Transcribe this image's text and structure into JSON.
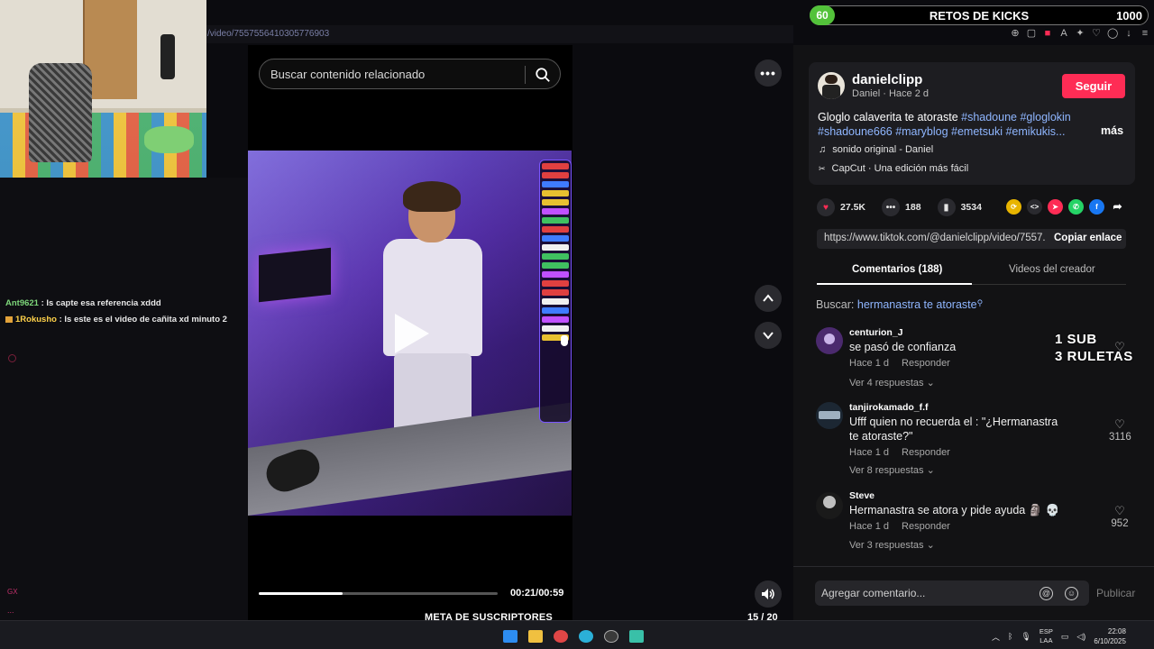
{
  "browser": {
    "url_fragment": "/video/7557556410305776903"
  },
  "chat": {
    "messages": [
      {
        "user": "Ant9621",
        "text": ": Is capte esa referencia xddd",
        "user_color": "#7dd67a"
      },
      {
        "user": "1Rokusho",
        "text": ": Is este es el video de cañita xd minuto 2",
        "user_color": "#ffd24a"
      }
    ],
    "footer_tag": "GX",
    "footer_more": "..."
  },
  "video_panel": {
    "search_placeholder": "Buscar contenido relacionado",
    "time": "00:21/00:59",
    "progress": 0.35
  },
  "kicks_overlay": {
    "badge": "60",
    "title": "RETOS DE KICKS",
    "goal": "1000"
  },
  "post": {
    "creator": "danielclipp",
    "subline": "Daniel · Hace 2 d",
    "follow_label": "Seguir",
    "caption": "Gloglo calaverita te atoraste ",
    "hashtags_line1": "#shadoune #gloglokin",
    "hashtags_line2": "#shadoune666 #maryblog #emetsuki #emikukis...",
    "more_label": "más",
    "sound": "sonido original - Daniel",
    "capcut": "CapCut · Una edición más fácil",
    "likes": "27.5K",
    "comments": "188",
    "saves": "3534",
    "link": "https://www.tiktok.com/@danielclipp/video/7557...",
    "copy_label": "Copiar enlace"
  },
  "tabs": {
    "comments": "Comentarios (188)",
    "creator_videos": "Videos del creador"
  },
  "search_suggestion": {
    "label": "Buscar:",
    "query": "hermanastra te atoraste"
  },
  "comments": [
    {
      "user": "centurion_J",
      "text": "se pasó de confianza",
      "time": "Hace 1 d",
      "reply": "Responder",
      "more": "Ver 4 respuestas",
      "likes": ""
    },
    {
      "user": "tanjirokamado_f.f",
      "text": "Ufff quien no recuerda el : \"¿Hermanastra te atoraste?\"",
      "time": "Hace 1 d",
      "reply": "Responder",
      "more": "Ver 8 respuestas",
      "likes": "3116"
    },
    {
      "user": "Steve",
      "text": "Hermanastra se atora y pide ayuda 🗿 💀",
      "time": "Hace 1 d",
      "reply": "Responder",
      "more": "Ver 3 respuestas",
      "likes": "952"
    }
  ],
  "stream_overlay": {
    "line1": "1 SUB",
    "line2": "3 RULETAS"
  },
  "comment_box": {
    "placeholder": "Agregar comentario...",
    "publish_label": "Publicar"
  },
  "sub_goal": {
    "title": "META DE SUSCRIPTORES",
    "count": "15 / 20",
    "progress": 0.75
  },
  "taskbar": {
    "lang_line1": "ESP",
    "lang_line2": "LAA",
    "time": "22:08",
    "date": "6/10/2025"
  },
  "colors": {
    "accent": "#fe2c55",
    "hashtag": "#8fb6ff",
    "goal_green": "#2fd24a",
    "kick_green": "#53c23a"
  }
}
